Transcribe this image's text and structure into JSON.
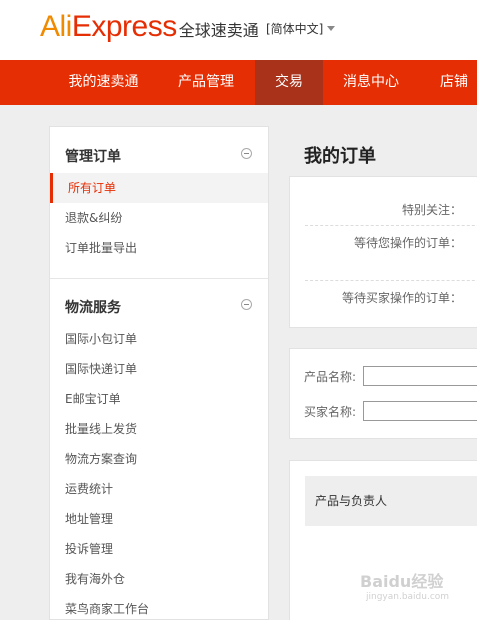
{
  "header": {
    "logo_brand": "AliExpress",
    "logo_sub": "全球速卖通",
    "language": "[简体中文]"
  },
  "nav": {
    "items": [
      "我的速卖通",
      "产品管理",
      "交易",
      "消息中心",
      "店铺"
    ],
    "active": "交易"
  },
  "sidebar": {
    "sections": [
      {
        "title": "管理订单",
        "items": [
          "所有订单",
          "退款&纠纷",
          "订单批量导出"
        ],
        "active": "所有订单"
      },
      {
        "title": "物流服务",
        "items": [
          "国际小包订单",
          "国际快递订单",
          "E邮宝订单",
          "批量线上发货",
          "物流方案查询",
          "运费统计",
          "地址管理",
          "投诉管理",
          "我有海外仓",
          "菜鸟商家工作台"
        ]
      }
    ]
  },
  "main": {
    "title": "我的订单",
    "stats": [
      "特别关注：",
      "等待您操作的订单：",
      "等待买家操作的订单："
    ],
    "search": {
      "product_label": "产品名称:",
      "buyer_label": "买家名称:",
      "product_value": "",
      "buyer_value": ""
    },
    "table_header": "产品与负责人"
  },
  "watermark": {
    "text": "Baidu经验",
    "sub": "jingyan.baidu.com"
  },
  "colors": {
    "brand": "#e62e04",
    "nav_active": "#a8321a"
  }
}
